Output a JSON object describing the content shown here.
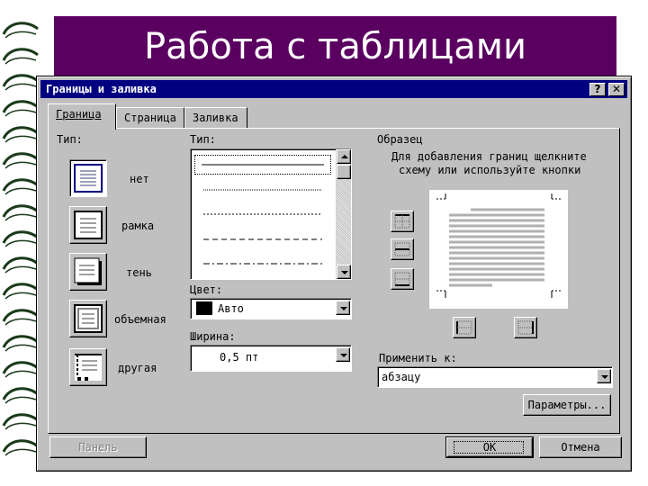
{
  "slide": {
    "title": "Работа с таблицами"
  },
  "dialog": {
    "title": "Границы и заливка",
    "help_label": "?",
    "close_label": "✕",
    "tabs": [
      {
        "label": "Граница",
        "active": true
      },
      {
        "label": "Страница",
        "active": false
      },
      {
        "label": "Заливка",
        "active": false
      }
    ],
    "type_section": {
      "label": "Тип:",
      "presets": [
        {
          "label": "нет",
          "icon": "border-none-icon"
        },
        {
          "label": "рамка",
          "icon": "border-box-icon"
        },
        {
          "label": "тень",
          "icon": "border-shadow-icon"
        },
        {
          "label": "объемная",
          "icon": "border-3d-icon"
        },
        {
          "label": "другая",
          "icon": "border-custom-icon"
        }
      ]
    },
    "style_section": {
      "label": "Тип:",
      "line_styles": [
        "solid",
        "dotted",
        "dashed",
        "dash-long",
        "dash-dot"
      ]
    },
    "color": {
      "label": "Цвет:",
      "value": "Авто",
      "swatch": "#000000"
    },
    "width": {
      "label": "Ширина:",
      "value": "0,5 пт"
    },
    "preview": {
      "label": "Образец",
      "hint_line1": "Для добавления границ щелкните",
      "hint_line2": "схему или используйте кнопки"
    },
    "apply_to": {
      "label": "Применить к:",
      "value": "абзацу"
    },
    "buttons": {
      "options": "Параметры...",
      "toolbar": "Панель",
      "ok": "ОК",
      "cancel": "Отмена"
    }
  },
  "colors": {
    "title_bar": "#000080",
    "slide_banner": "#5a0060",
    "window_face": "#c0c0c0"
  }
}
